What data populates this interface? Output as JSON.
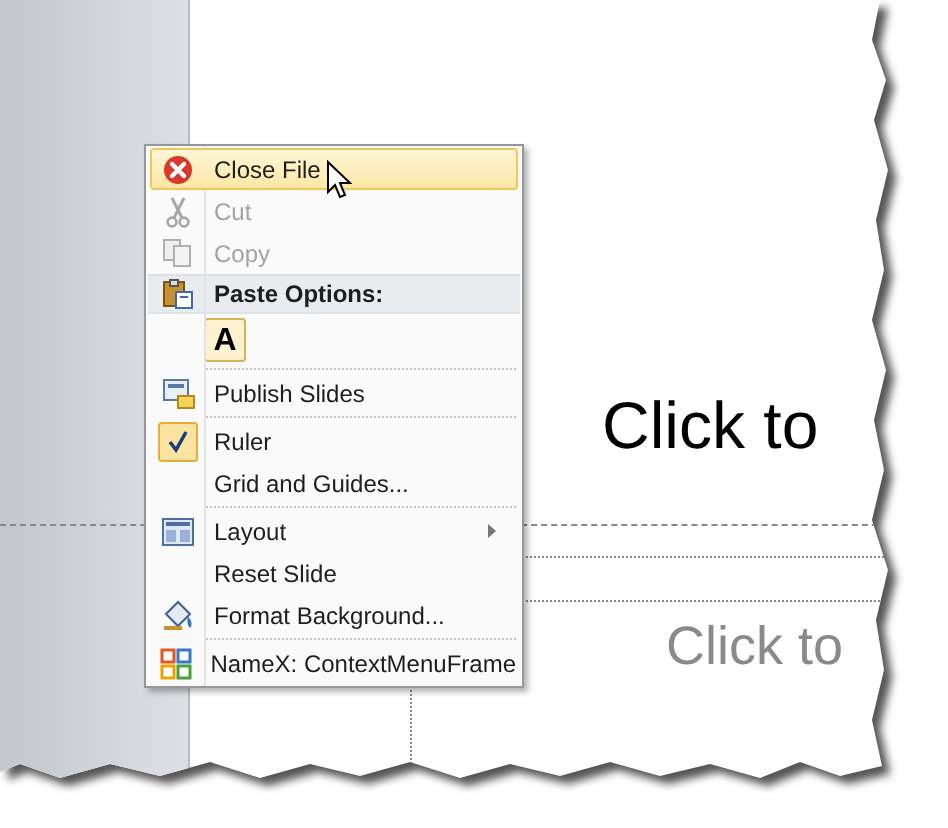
{
  "slide": {
    "title_placeholder": "Click to",
    "subtitle_placeholder": "Click to"
  },
  "menu": {
    "items": [
      {
        "kind": "item",
        "label": "Close File",
        "highlighted": true,
        "disabled": false,
        "checked": false,
        "submenu": false
      },
      {
        "kind": "item",
        "label": "Cut",
        "highlighted": false,
        "disabled": true,
        "checked": false,
        "submenu": false
      },
      {
        "kind": "item",
        "label": "Copy",
        "highlighted": false,
        "disabled": true,
        "checked": false,
        "submenu": false
      },
      {
        "kind": "header",
        "label": "Paste Options:"
      },
      {
        "kind": "paste",
        "label": "A"
      },
      {
        "kind": "separator"
      },
      {
        "kind": "item",
        "label": "Publish Slides",
        "highlighted": false,
        "disabled": false,
        "checked": false,
        "submenu": false
      },
      {
        "kind": "separator"
      },
      {
        "kind": "item",
        "label": "Ruler",
        "highlighted": false,
        "disabled": false,
        "checked": true,
        "submenu": false
      },
      {
        "kind": "item",
        "label": "Grid and Guides...",
        "highlighted": false,
        "disabled": false,
        "checked": false,
        "submenu": false
      },
      {
        "kind": "separator"
      },
      {
        "kind": "item",
        "label": "Layout",
        "highlighted": false,
        "disabled": false,
        "checked": false,
        "submenu": true
      },
      {
        "kind": "item",
        "label": "Reset Slide",
        "highlighted": false,
        "disabled": false,
        "checked": false,
        "submenu": false
      },
      {
        "kind": "item",
        "label": "Format Background...",
        "highlighted": false,
        "disabled": false,
        "checked": false,
        "submenu": false
      },
      {
        "kind": "separator"
      },
      {
        "kind": "item",
        "label": "NameX: ContextMenuFrame",
        "highlighted": false,
        "disabled": false,
        "checked": false,
        "submenu": false
      }
    ]
  }
}
